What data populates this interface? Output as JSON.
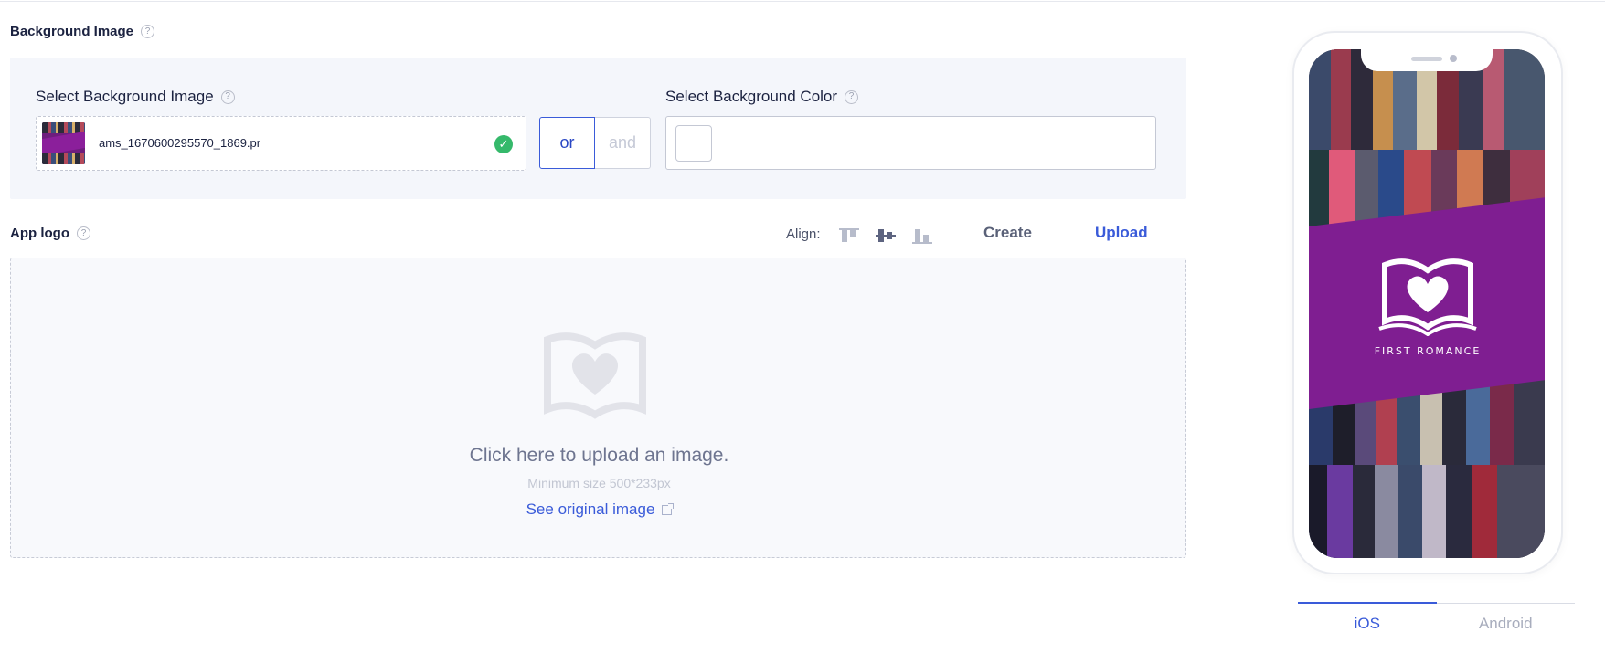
{
  "background": {
    "section_title": "Background Image",
    "image_label": "Select Background Image",
    "file_name": "ams_1670600295570_1869.pr",
    "toggle": {
      "or": "or",
      "and": "and",
      "selected": "or"
    },
    "color_label": "Select Background Color",
    "color_value": "#ffffff"
  },
  "logo": {
    "section_title": "App logo",
    "align_label": "Align:",
    "align_options": [
      "align-top-icon",
      "align-middle-icon",
      "align-bottom-icon"
    ],
    "tabs": {
      "create": "Create",
      "upload": "Upload",
      "active": "Upload"
    },
    "upload_title": "Click here to upload an image.",
    "upload_hint": "Minimum size 500*233px",
    "see_original": "See original image"
  },
  "preview": {
    "brand_text": "FIRST ROMANCE",
    "brand_color": "#7f1e91",
    "os_tabs": [
      "iOS",
      "Android"
    ],
    "active_os": "iOS"
  },
  "colors": {
    "accent": "#3a5bd9",
    "success": "#35b96b"
  }
}
